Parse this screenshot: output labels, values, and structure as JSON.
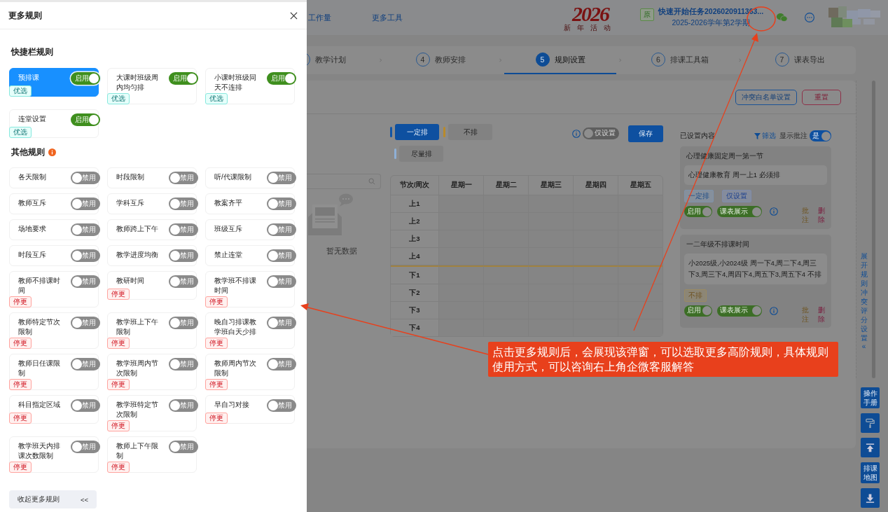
{
  "drawer": {
    "title": "更多规则",
    "quick_title": "快捷栏规则",
    "quick_rules": [
      {
        "label": "预排课",
        "selected": true,
        "on": true,
        "toggle_text": "启用",
        "badge": {
          "kind": "preferred",
          "text": "优选"
        }
      },
      {
        "label": "大课时班级周内均匀排",
        "selected": false,
        "on": true,
        "toggle_text": "启用",
        "badge": {
          "kind": "preferred",
          "text": "优选"
        }
      },
      {
        "label": "小课时班级同天不连排",
        "selected": false,
        "on": true,
        "toggle_text": "启用",
        "badge": {
          "kind": "preferred",
          "text": "优选"
        }
      },
      {
        "label": "连堂设置",
        "selected": false,
        "on": true,
        "toggle_text": "启用",
        "badge": {
          "kind": "preferred",
          "text": "优选"
        }
      }
    ],
    "other_title": "其他规则",
    "other_rules": [
      {
        "label": "各天限制",
        "on": false,
        "toggle_text": "禁用"
      },
      {
        "label": "时段限制",
        "on": false,
        "toggle_text": "禁用"
      },
      {
        "label": "听/代课限制",
        "on": false,
        "toggle_text": "禁用"
      },
      {
        "label": "教师互斥",
        "on": false,
        "toggle_text": "禁用"
      },
      {
        "label": "学科互斥",
        "on": false,
        "toggle_text": "禁用"
      },
      {
        "label": "教案齐平",
        "on": false,
        "toggle_text": "禁用"
      },
      {
        "label": "场地要求",
        "on": false,
        "toggle_text": "禁用"
      },
      {
        "label": "教师跨上下午",
        "on": false,
        "toggle_text": "禁用"
      },
      {
        "label": "班级互斥",
        "on": false,
        "toggle_text": "禁用"
      },
      {
        "label": "时段互斥",
        "on": false,
        "toggle_text": "禁用"
      },
      {
        "label": "教学进度均衡",
        "on": false,
        "toggle_text": "禁用"
      },
      {
        "label": "禁止连堂",
        "on": false,
        "toggle_text": "禁用"
      },
      {
        "label": "教师不排课时间",
        "on": false,
        "toggle_text": "禁用",
        "badge": {
          "kind": "stopped",
          "text": "停更"
        }
      },
      {
        "label": "教研时间",
        "on": false,
        "toggle_text": "禁用",
        "badge": {
          "kind": "stopped",
          "text": "停更"
        }
      },
      {
        "label": "教学班不排课时间",
        "on": false,
        "toggle_text": "禁用",
        "badge": {
          "kind": "stopped",
          "text": "停更"
        }
      },
      {
        "label": "教师特定节次限制",
        "on": false,
        "toggle_text": "禁用",
        "badge": {
          "kind": "stopped",
          "text": "停更"
        }
      },
      {
        "label": "教学班上下午限制",
        "on": false,
        "toggle_text": "禁用",
        "badge": {
          "kind": "stopped",
          "text": "停更"
        }
      },
      {
        "label": "晚自习排课教学班白天少排",
        "on": false,
        "toggle_text": "禁用",
        "badge": {
          "kind": "stopped",
          "text": "停更"
        }
      },
      {
        "label": "教师日任课限制",
        "on": false,
        "toggle_text": "禁用",
        "badge": {
          "kind": "stopped",
          "text": "停更"
        }
      },
      {
        "label": "教学班周内节次限制",
        "on": false,
        "toggle_text": "禁用",
        "badge": {
          "kind": "stopped",
          "text": "停更"
        }
      },
      {
        "label": "教师周内节次限制",
        "on": false,
        "toggle_text": "禁用",
        "badge": {
          "kind": "stopped",
          "text": "停更"
        }
      },
      {
        "label": "科目指定区域",
        "on": false,
        "toggle_text": "禁用",
        "badge": {
          "kind": "stopped",
          "text": "停更"
        }
      },
      {
        "label": "教学班特定节次限制",
        "on": false,
        "toggle_text": "禁用",
        "badge": {
          "kind": "stopped",
          "text": "停更"
        }
      },
      {
        "label": "早自习对接",
        "on": false,
        "toggle_text": "禁用",
        "badge": {
          "kind": "stopped",
          "text": "停更"
        }
      },
      {
        "label": "教学班天内排课次数限制",
        "on": false,
        "toggle_text": "禁用",
        "badge": {
          "kind": "stopped",
          "text": "停更"
        }
      },
      {
        "label": "教师上下午限制",
        "on": false,
        "toggle_text": "禁用",
        "badge": {
          "kind": "stopped",
          "text": "停更"
        }
      }
    ],
    "collapse_button": {
      "label": "收起更多规则",
      "arrow": "<<"
    }
  },
  "header": {
    "nav": [
      "工作量",
      "更多工具"
    ],
    "logo": {
      "year": "2026",
      "tagline": "新年活动"
    },
    "task": {
      "badge": "原",
      "name": "快速开始任务2026020911363...",
      "term": "2025-2026学年第2学期"
    }
  },
  "steps": [
    {
      "label": "教学计划",
      "selected": false
    },
    {
      "number": "4",
      "label": "教师安排",
      "selected": false
    },
    {
      "number": "5",
      "label": "规则设置",
      "selected": true
    },
    {
      "number": "6",
      "label": "排课工具箱",
      "selected": false
    },
    {
      "number": "7",
      "label": "课表导出",
      "selected": false
    }
  ],
  "actions": [
    {
      "label": "冲突白名单设置",
      "kind": "primary"
    },
    {
      "label": "重置",
      "kind": "danger"
    }
  ],
  "legend": [
    {
      "label": "一定排",
      "selected": true,
      "color": "#1155a6"
    },
    {
      "label": "不排",
      "selected": false,
      "color": "#b98a2a"
    },
    {
      "label": "尽量排",
      "selected": false,
      "color": "#8fb0d6"
    }
  ],
  "only_settings": {
    "label": "仅设置",
    "on": false
  },
  "save": "保存",
  "empty_state": "暂无数据",
  "table": {
    "columns": [
      "节次/周次",
      "星期一",
      "星期二",
      "星期三",
      "星期四",
      "星期五"
    ],
    "rows": [
      {
        "label": "上1",
        "divider_above": false
      },
      {
        "label": "上2",
        "divider_above": false
      },
      {
        "label": "上3",
        "divider_above": false
      },
      {
        "label": "上4",
        "divider_above": false
      },
      {
        "label": "下1",
        "divider_above": true
      },
      {
        "label": "下2",
        "divider_above": false
      },
      {
        "label": "下3",
        "divider_above": false
      },
      {
        "label": "下4",
        "divider_above": false
      }
    ]
  },
  "settings_panel": {
    "title": "已设置内容",
    "filter": "筛选",
    "show_notes": {
      "label": "显示批注",
      "on": true,
      "text": "是"
    },
    "cards": [
      {
        "title": "心理健康固定周一第一节",
        "detail": "心理健康教育 周一上1 必须排",
        "tags": [
          {
            "text": "一定排",
            "kind": "must"
          },
          {
            "text": "仅设置",
            "kind": "setting"
          }
        ],
        "enabled": {
          "on": true,
          "text": "启用"
        },
        "display": {
          "on": true,
          "text": "课表展示"
        },
        "note": "批注",
        "delete": "删除"
      },
      {
        "title": "一二年级不排课时间",
        "detail": "小2025级,小2024级 周一下4,周二下4,周三下3,周三下4,周四下4,周五下3,周五下4 不排",
        "tags": [
          {
            "text": "不排",
            "kind": "never"
          }
        ],
        "enabled": {
          "on": true,
          "text": "启用"
        },
        "display": {
          "on": true,
          "text": "课表展示"
        },
        "note": "批注",
        "delete": "删除"
      }
    ]
  },
  "side_tab": {
    "label": "展开规则冲突评分设置",
    "arrow": "«"
  },
  "float_buttons": [
    {
      "kind": "text",
      "label": "操作手册"
    },
    {
      "kind": "paint"
    },
    {
      "kind": "top"
    },
    {
      "kind": "text",
      "label": "排课地图"
    },
    {
      "kind": "download"
    }
  ],
  "annotation": {
    "text": "点击更多规则后，会展现该弹窗，可以选取更多高阶规则，具体规则使用方式，可以咨询右上角企微客服解答"
  }
}
